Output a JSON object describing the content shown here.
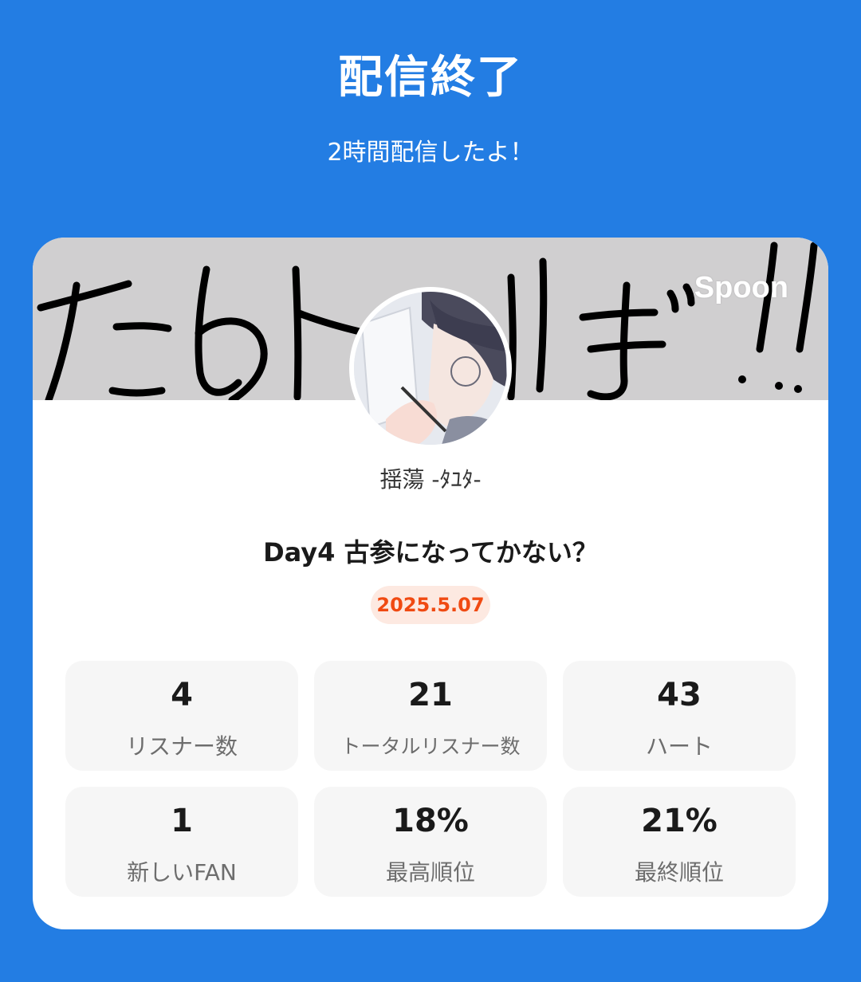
{
  "header": {
    "title": "配信終了",
    "subtitle": "2時間配信したよ！"
  },
  "card": {
    "brand": "Spoon",
    "owner_name": "揺蕩 -ﾀﾕﾀ-",
    "live_title": "Day4 古参になってかない？",
    "date": "2025.5.07",
    "colors": {
      "background": "#237de3",
      "date_badge_text": "#f04a12",
      "date_badge_bg": "#fde9e1"
    },
    "stats": [
      {
        "value": "4",
        "label": "リスナー数"
      },
      {
        "value": "21",
        "label": "トータルリスナー数"
      },
      {
        "value": "43",
        "label": "ハート"
      },
      {
        "value": "1",
        "label": "新しいFAN"
      },
      {
        "value": "18%",
        "label": "最高順位"
      },
      {
        "value": "21%",
        "label": "最終順位"
      }
    ]
  }
}
